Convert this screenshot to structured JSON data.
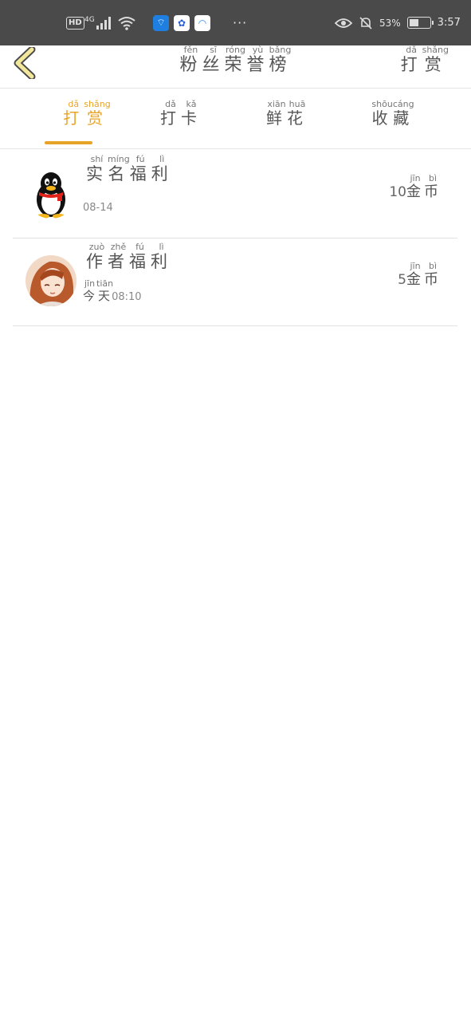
{
  "status_bar": {
    "hd": "HD",
    "network": "4G",
    "dots": "···",
    "battery_pct": "53%",
    "battery_level": 0.53,
    "time": "3:57",
    "app_icons": [
      "wifi-sharing-app-icon",
      "baidu-app-icon",
      "browser-app-icon"
    ]
  },
  "header": {
    "title": [
      {
        "hz": "粉",
        "py": "fěn"
      },
      {
        "hz": "丝",
        "py": "sī"
      },
      {
        "hz": "荣",
        "py": "róng"
      },
      {
        "hz": "誉",
        "py": "yù"
      },
      {
        "hz": "榜",
        "py": "bǎng"
      }
    ],
    "right_action": [
      {
        "hz": "打",
        "py": "dǎ"
      },
      {
        "hz": "赏",
        "py": "shǎng"
      }
    ]
  },
  "tabs": [
    {
      "active": true,
      "chars": [
        {
          "hz": "打",
          "py": "dǎ"
        },
        {
          "hz": "赏",
          "py": "shǎng"
        }
      ]
    },
    {
      "active": false,
      "chars": [
        {
          "hz": "打",
          "py": "dǎ"
        },
        {
          "hz": "卡",
          "py": "kǎ"
        }
      ]
    },
    {
      "active": false,
      "chars": [
        {
          "hz": "鲜",
          "py": "xiān"
        },
        {
          "hz": "花",
          "py": "huā"
        }
      ]
    },
    {
      "active": false,
      "chars": [
        {
          "hz": "收",
          "py": "shōu"
        },
        {
          "hz": "藏",
          "py": "cáng"
        }
      ]
    }
  ],
  "records": [
    {
      "name": [
        {
          "hz": "实",
          "py": "shí"
        },
        {
          "hz": "名",
          "py": "míng"
        },
        {
          "hz": "福",
          "py": "fú"
        },
        {
          "hz": "利",
          "py": "lì"
        }
      ],
      "date_prefix": [],
      "date": "08-14",
      "amount_number": "10",
      "amount_unit": [
        {
          "hz": "金",
          "py": "jīn"
        },
        {
          "hz": "币",
          "py": "bì"
        }
      ],
      "avatar": "penguin-avatar"
    },
    {
      "name": [
        {
          "hz": "作",
          "py": "zuò"
        },
        {
          "hz": "者",
          "py": "zhě"
        },
        {
          "hz": "福",
          "py": "fú"
        },
        {
          "hz": "利",
          "py": "lì"
        }
      ],
      "date_prefix": [
        {
          "hz": "今",
          "py": "jīn"
        },
        {
          "hz": "天",
          "py": "tiān"
        }
      ],
      "date": "08:10",
      "amount_number": "5",
      "amount_unit": [
        {
          "hz": "金",
          "py": "jīn"
        },
        {
          "hz": "币",
          "py": "bì"
        }
      ],
      "avatar": "anime-girl-avatar"
    }
  ]
}
